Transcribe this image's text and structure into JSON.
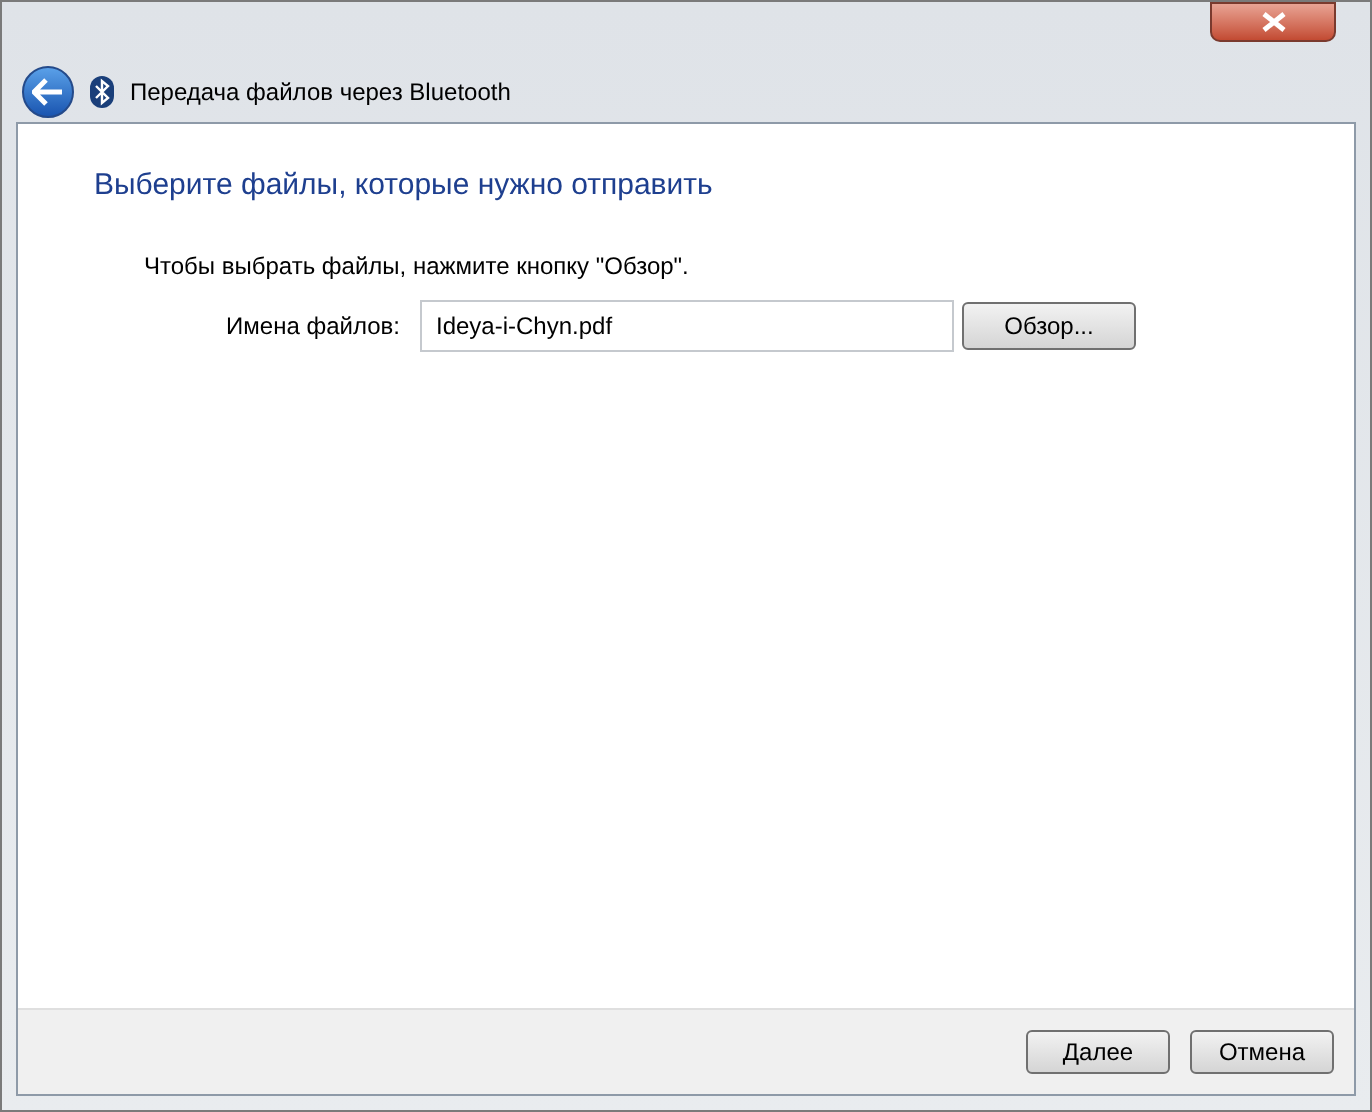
{
  "window": {
    "title": "Передача файлов через Bluetooth"
  },
  "heading": "Выберите файлы, которые нужно отправить",
  "instruction": "Чтобы выбрать файлы, нажмите кнопку \"Обзор\".",
  "file_field": {
    "label": "Имена файлов:",
    "value": "Ideya-i-Chyn.pdf"
  },
  "browse_button": "Обзор...",
  "buttons": [
    "Далее",
    "Отмена"
  ]
}
